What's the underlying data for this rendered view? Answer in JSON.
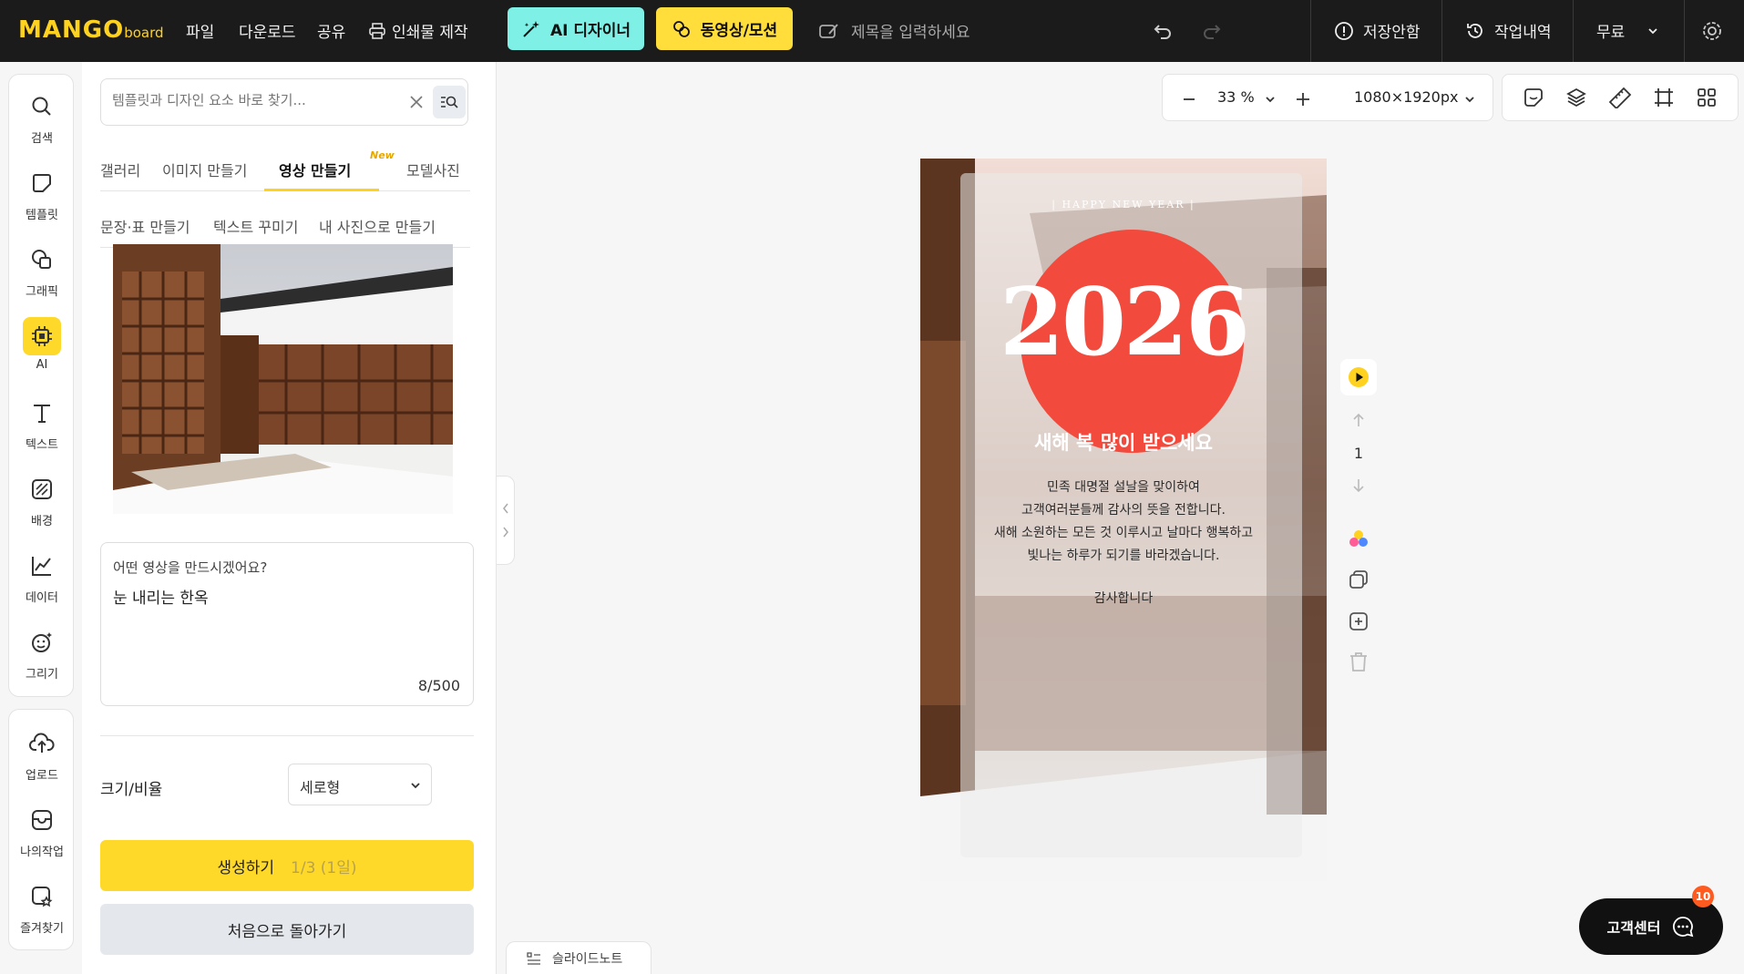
{
  "topbar": {
    "logo_main": "MANGO",
    "logo_sub": "board",
    "menu": [
      "파일",
      "다운로드",
      "공유",
      "인쇄물 제작"
    ],
    "ai_designer": "AI 디자이너",
    "video_motion": "동영상/모션",
    "title_placeholder": "제목을 입력하세요",
    "save_status": "저장안함",
    "history": "작업내역",
    "plan": "무료",
    "colors": {
      "ai_designer_bg": "#7ef0e6",
      "video_bg": "#ffde3c",
      "bar_bg": "#1b1b1b"
    }
  },
  "left_rail": {
    "items": [
      {
        "label": "검색",
        "icon": "search-icon"
      },
      {
        "label": "템플릿",
        "icon": "template-icon"
      },
      {
        "label": "그래픽",
        "icon": "graphic-icon"
      },
      {
        "label": "AI",
        "icon": "ai-chip-icon"
      },
      {
        "label": "텍스트",
        "icon": "text-icon"
      },
      {
        "label": "배경",
        "icon": "background-icon"
      },
      {
        "label": "데이터",
        "icon": "chart-icon"
      },
      {
        "label": "그리기",
        "icon": "draw-icon"
      }
    ],
    "items2": [
      {
        "label": "업로드",
        "icon": "upload-icon"
      },
      {
        "label": "나의작업",
        "icon": "my-work-icon"
      },
      {
        "label": "즐겨찾기",
        "icon": "favorites-icon"
      }
    ]
  },
  "panel": {
    "search_placeholder": "템플릿과 디자인 요소 바로 찾기...",
    "tabs": [
      "갤러리",
      "이미지 만들기",
      "영상 만들기",
      "모델사진"
    ],
    "new_badge": "New",
    "subtabs": [
      "문장·표 만들기",
      "텍스트 꾸미기",
      "내 사진으로 만들기"
    ],
    "prompt_label": "어떤 영상을 만드시겠어요?",
    "prompt_value": "눈 내리는 한옥",
    "char_count": "8/500",
    "size_label": "크기/비율",
    "size_value": "세로형",
    "generate": "생성하기",
    "generate_quota": "1/3 (1일)",
    "back": "처음으로 돌아가기"
  },
  "zoom": {
    "percent": "33 %",
    "size": "1080×1920px"
  },
  "canvas": {
    "happy": "| HAPPY NEW YEAR |",
    "year": "2026",
    "greeting": "새해 복 많이 받으세요",
    "body": [
      "민족 대명절 설날을 맞이하여",
      "고객여러분들께 감사의 뜻을 전합니다.",
      "새해 소원하는 모든 것 이루시고 날마다 행복하고",
      "빛나는 하루가 되기를 바라겠습니다."
    ],
    "thanks": "감사합니다"
  },
  "page_nav": {
    "page": "1"
  },
  "slide_note": "슬라이드노트",
  "support": {
    "label": "고객센터",
    "badge": "10"
  }
}
